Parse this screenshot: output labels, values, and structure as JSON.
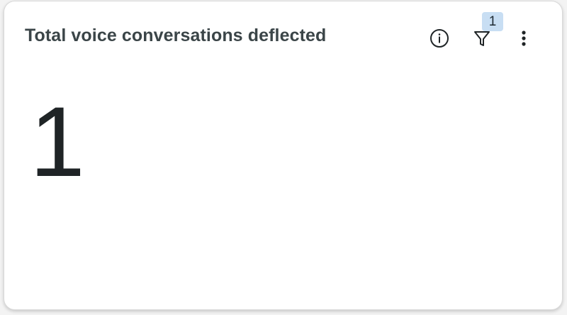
{
  "card": {
    "title": "Total voice conversations deflected",
    "value": "1"
  },
  "header_actions": {
    "info_icon": "info-circle-icon",
    "filter_icon": "filter-funnel-icon",
    "filter_count": "1",
    "more_icon": "vertical-ellipsis-icon"
  },
  "colors": {
    "title_text": "#3b4548",
    "value_text": "#1f2426",
    "badge_bg": "#c8def3",
    "card_bg": "#ffffff"
  }
}
